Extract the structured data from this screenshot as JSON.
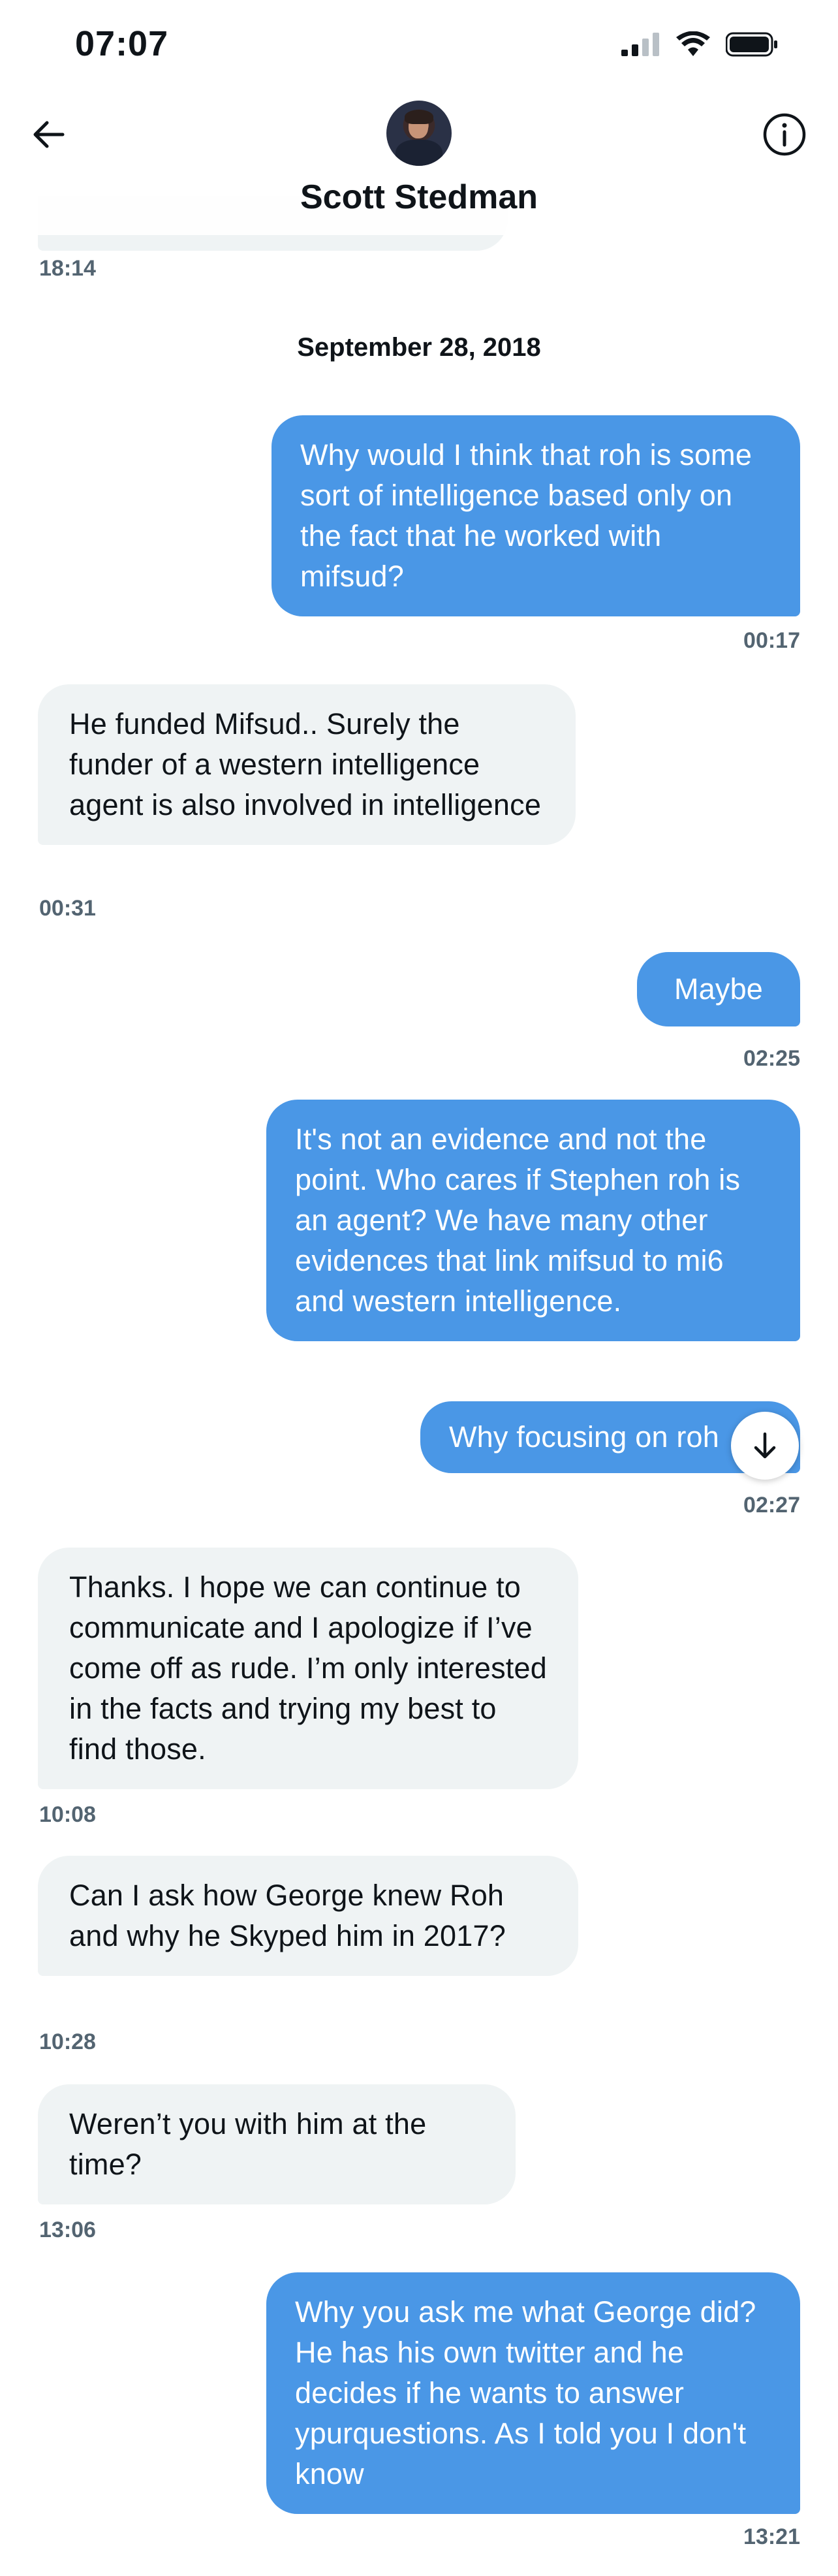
{
  "status_bar": {
    "time": "07:07"
  },
  "header": {
    "contact_name": "Scott Stedman"
  },
  "date_separator": "September 28, 2018",
  "top_timestamp": "18:14",
  "messages": [
    {
      "direction": "out",
      "text": "Why would I think that roh is some sort of intelligence based only on the fact that he worked with mifsud?",
      "time": "00:17"
    },
    {
      "direction": "in",
      "text": "He funded Mifsud.. Surely the funder of a western intelligence agent is also involved in intelligence",
      "time": "00:31"
    },
    {
      "direction": "out",
      "text": "Maybe",
      "time": "02:25"
    },
    {
      "direction": "out",
      "text": "It's not an evidence and not the point.  Who cares if Stephen roh is an agent? We have many other evidences that link mifsud to mi6 and western intelligence.",
      "time": ""
    },
    {
      "direction": "out",
      "text": "Why focusing on roh",
      "time": "02:27"
    },
    {
      "direction": "in",
      "text": "Thanks. I hope we can continue to communicate and I apologize if I’ve come off as rude. I’m only interested in the facts and trying my best to find those.",
      "time": "10:08"
    },
    {
      "direction": "in",
      "text": "Can I ask how George knew Roh and why he Skyped him in 2017?",
      "time": "10:28"
    },
    {
      "direction": "in",
      "text": "Weren’t you with him at the time?",
      "time": "13:06"
    },
    {
      "direction": "out",
      "text": "Why you ask me what George did? He has his own twitter and he decides if he wants to answer ypurquestions.  As I told you I don't know",
      "time": "13:21"
    }
  ],
  "colors": {
    "outgoing_bubble": "#4a97e6",
    "incoming_bubble": "#eff3f4",
    "timestamp": "#536471"
  },
  "icons": {
    "back": "arrow-left-icon",
    "info": "info-icon",
    "scroll": "arrow-down-icon"
  }
}
